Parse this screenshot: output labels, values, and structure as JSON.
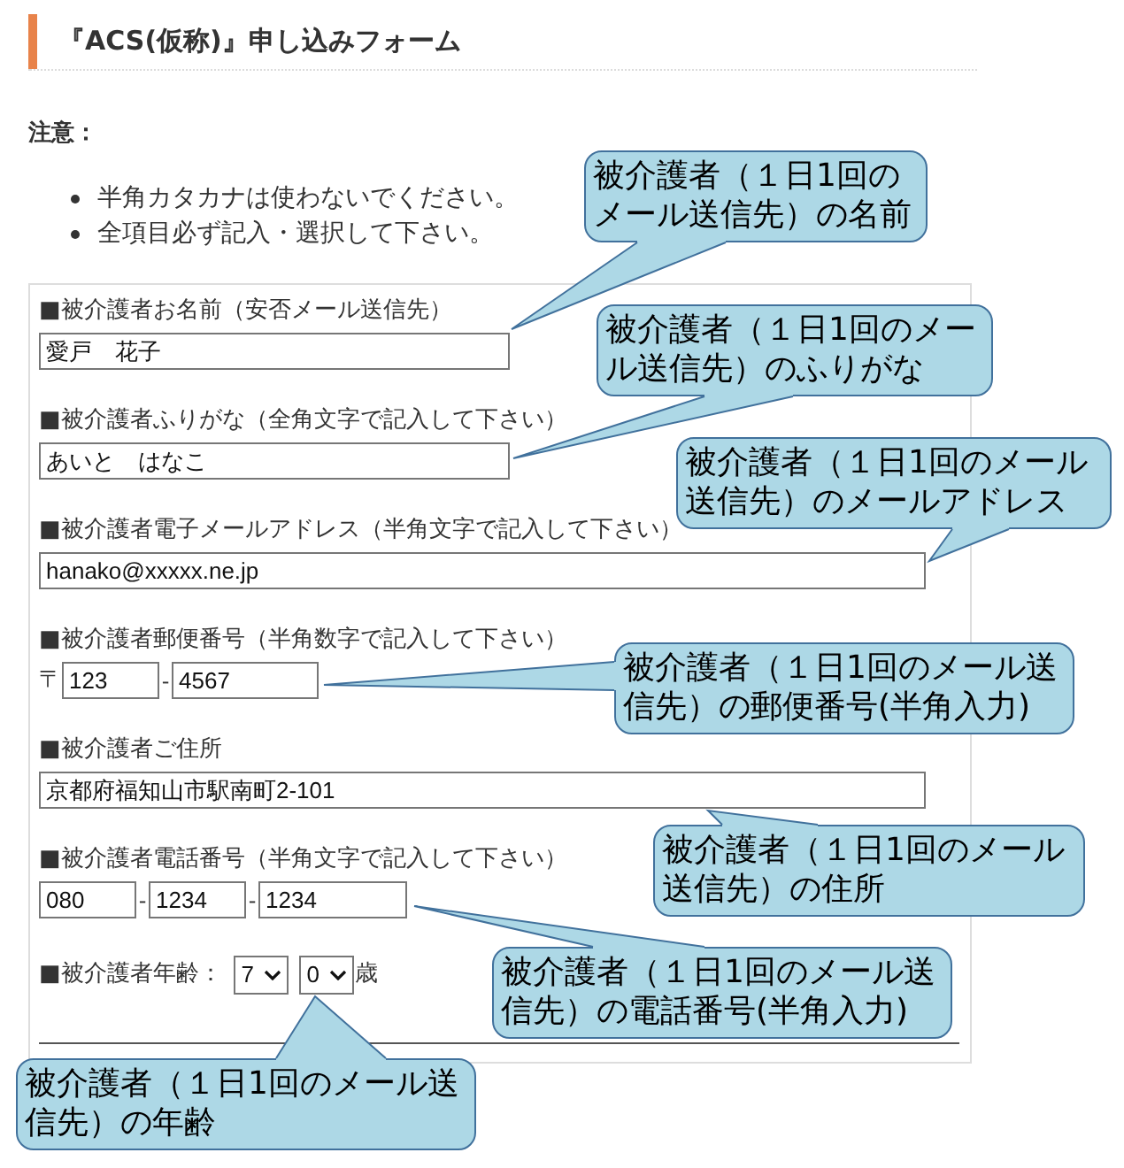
{
  "heading": {
    "title": "『ACS(仮称)』申し込みフォーム"
  },
  "notice": {
    "label": "注意：",
    "items": [
      "半角カタカナは使わないでください。",
      "全項目必ず記入・選択して下さい。"
    ]
  },
  "form": {
    "fields": [
      {
        "kind": "text",
        "label": "■被介護者お名前（安否メール送信先）",
        "value": "愛戸　花子",
        "callout": "被介護者（１日1回のメール送信先）の名前"
      },
      {
        "kind": "text",
        "label": "■被介護者ふりがな（全角文字で記入して下さい）",
        "value": "あいと　はなこ",
        "callout": "被介護者（１日1回のメール送信先）のふりがな"
      },
      {
        "kind": "wide_text",
        "label": "■被介護者電子メールアドレス（半角文字で記入して下さい）",
        "value": "hanako@xxxxx.ne.jp",
        "callout": "被介護者（１日1回のメール送信先）のメールアドレス"
      },
      {
        "kind": "postal",
        "label": "■被介護者郵便番号（半角数字で記入して下さい）",
        "prefix": "〒",
        "values": [
          "123",
          "4567"
        ],
        "separators": [
          "-"
        ],
        "callout": "被介護者（１日1回のメール送信先）の郵便番号(半角入力)"
      },
      {
        "kind": "wide_text",
        "label": "■被介護者ご住所",
        "value": "京都府福知山市駅南町2-101",
        "callout": "被介護者（１日1回のメール送信先）の住所"
      },
      {
        "kind": "phone",
        "label": "■被介護者電話番号（半角文字で記入して下さい）",
        "values": [
          "080",
          "1234",
          "1234"
        ],
        "separators": [
          "-",
          "-"
        ],
        "callout": "被介護者（１日1回のメール送信先）の電話番号(半角入力)"
      },
      {
        "kind": "age",
        "label": "■被介護者年齢：",
        "selects": [
          "7",
          "0"
        ],
        "suffix": "歳",
        "callout": "被介護者（１日1回のメール送信先）の年齢"
      }
    ]
  }
}
